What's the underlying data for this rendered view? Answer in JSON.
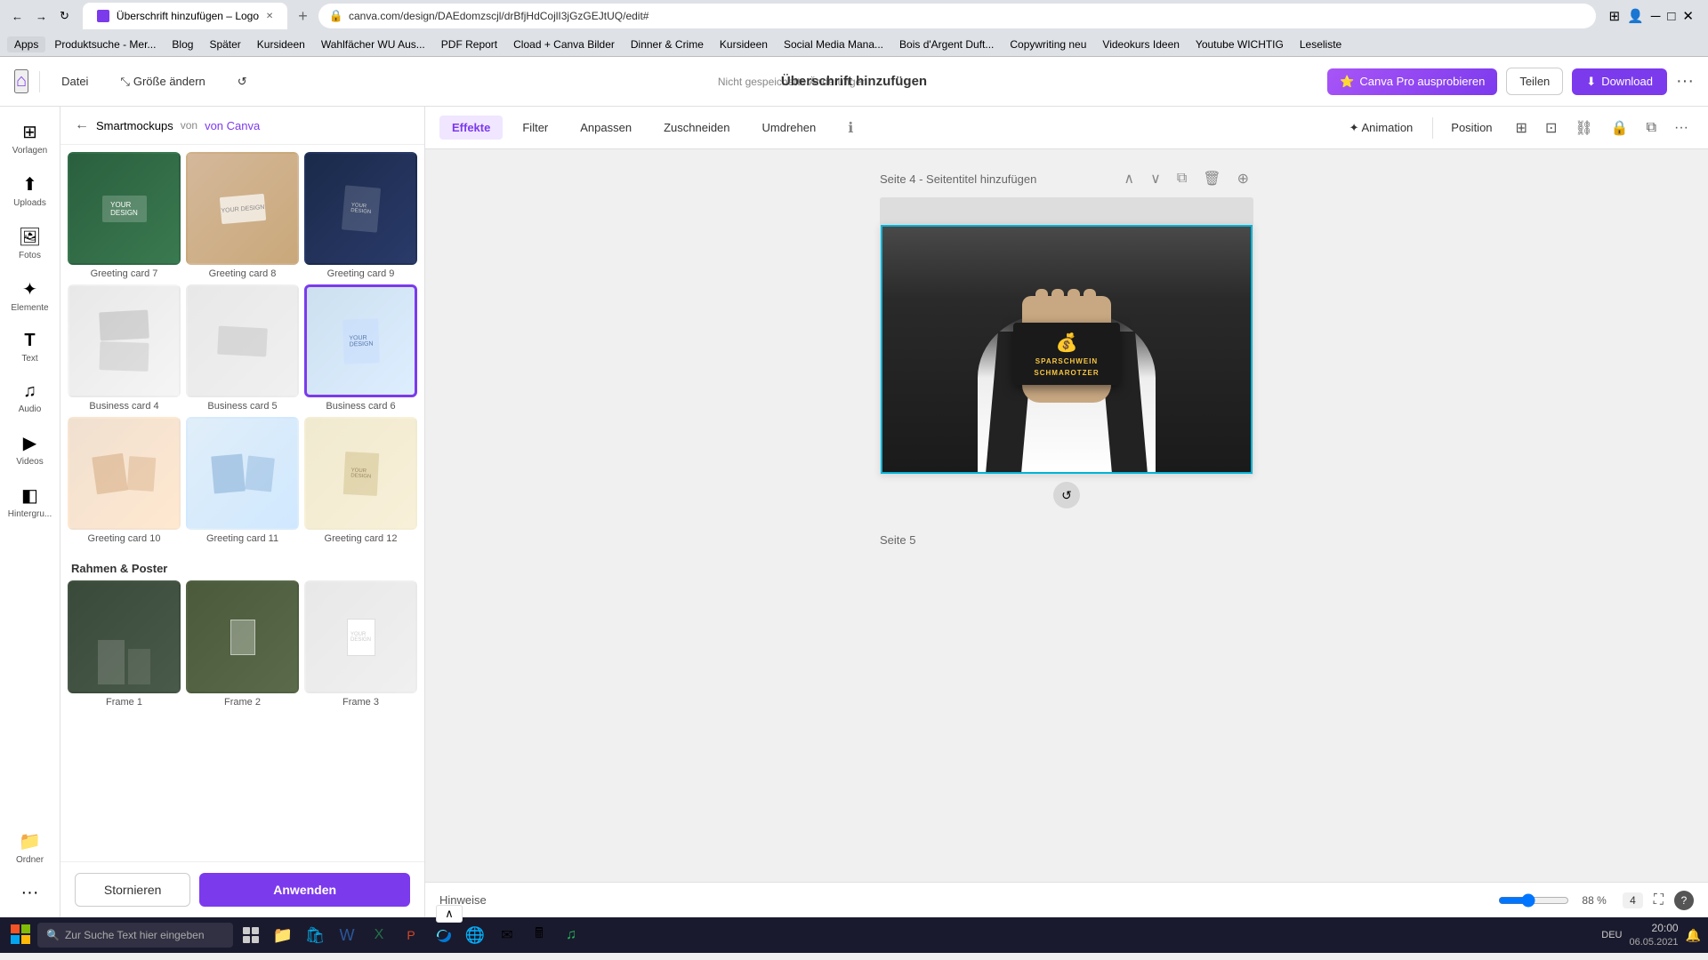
{
  "browser": {
    "tab_title": "Überschrift hinzufügen – Logo",
    "url": "canva.com/design/DAEdomzscjl/drBfjHdCojlI3jGzGEJtUQ/edit#",
    "bookmarks": [
      "Apps",
      "Produktsuche - Mer...",
      "Blog",
      "Später",
      "Kursideen",
      "Wahlfächer WU Aus...",
      "PDF Report",
      "Cload + Canva Bilder",
      "Dinner & Crime",
      "Kursideen",
      "Social Media Mana...",
      "Bois d'Argent Duft...",
      "Copywriting neu",
      "Videokurs Ideen",
      "Youtube WICHTIG",
      "Leseliste"
    ],
    "win_controls": [
      "─",
      "□",
      "✕"
    ]
  },
  "toolbar": {
    "home_label": "Startseite",
    "file_label": "Datei",
    "resize_label": "Größe ändern",
    "unsaved_label": "Nicht gespeicherte Änderungen",
    "project_title": "Überschrift hinzufügen",
    "canva_pro_label": "Canva Pro ausprobieren",
    "share_label": "Teilen",
    "download_label": "Download"
  },
  "sidebar_icons": [
    {
      "id": "vorlagen",
      "label": "Vorlagen",
      "icon": "⊞"
    },
    {
      "id": "uploads",
      "label": "Uploads",
      "icon": "↑"
    },
    {
      "id": "fotos",
      "label": "Fotos",
      "icon": "🖼"
    },
    {
      "id": "elemente",
      "label": "Elemente",
      "icon": "✦"
    },
    {
      "id": "text",
      "label": "Text",
      "icon": "T"
    },
    {
      "id": "audio",
      "label": "Audio",
      "icon": "♪"
    },
    {
      "id": "videos",
      "label": "Videos",
      "icon": "▶"
    },
    {
      "id": "hintergrund",
      "label": "Hintergru...",
      "icon": "◧"
    },
    {
      "id": "ordner",
      "label": "Ordner",
      "icon": "📁"
    },
    {
      "id": "more",
      "label": "...",
      "icon": "···"
    }
  ],
  "panel": {
    "back_label": "←",
    "title": "Smartmockups",
    "source_label": "von Canva",
    "sections": {
      "cards": {
        "items": [
          {
            "id": "greeting-7",
            "label": "Greeting card 7",
            "thumb_class": "thumb-greeting-7",
            "selected": false
          },
          {
            "id": "greeting-8",
            "label": "Greeting card 8",
            "thumb_class": "thumb-greeting-8",
            "selected": false
          },
          {
            "id": "greeting-9",
            "label": "Greeting card 9",
            "thumb_class": "thumb-greeting-9",
            "selected": false
          },
          {
            "id": "biz-4",
            "label": "Business card 4",
            "thumb_class": "thumb-biz-4",
            "selected": false
          },
          {
            "id": "biz-5",
            "label": "Business card 5",
            "thumb_class": "thumb-biz-5",
            "selected": false
          },
          {
            "id": "biz-6",
            "label": "Business card 6",
            "thumb_class": "thumb-biz-6",
            "selected": true
          },
          {
            "id": "greeting-10",
            "label": "Greeting card 10",
            "thumb_class": "thumb-greeting-10",
            "selected": false
          },
          {
            "id": "greeting-11",
            "label": "Greeting card 11",
            "thumb_class": "thumb-greeting-11",
            "selected": false
          },
          {
            "id": "greeting-12",
            "label": "Greeting card 12",
            "thumb_class": "thumb-greeting-12",
            "selected": false
          }
        ]
      },
      "frames": {
        "title": "Rahmen & Poster",
        "items": [
          {
            "id": "frame-1",
            "label": "Frame 1",
            "thumb_class": "thumb-frame-1"
          },
          {
            "id": "frame-2",
            "label": "Frame 2",
            "thumb_class": "thumb-frame-2"
          },
          {
            "id": "frame-3",
            "label": "Frame 3",
            "thumb_class": "thumb-frame-3"
          }
        ]
      }
    },
    "cancel_label": "Stornieren",
    "apply_label": "Anwenden"
  },
  "effect_toolbar": {
    "tabs": [
      "Effekte",
      "Filter",
      "Anpassen",
      "Zuschneiden",
      "Umdrehen"
    ],
    "active_tab": "Effekte",
    "info_icon": "ℹ",
    "animation_label": "Animation",
    "position_label": "Position",
    "icons": [
      "⊞",
      "⊡",
      "⛓",
      "🔒",
      "⧉",
      "⋯"
    ]
  },
  "canvas": {
    "page4": {
      "label": "Seite 4 - Seitentitel hinzufügen",
      "actions": [
        "∧",
        "∨",
        "⧉",
        "🗑",
        "⊕"
      ]
    },
    "page5": {
      "label": "Seite 5"
    },
    "card_text_line1": "SPARSCHWEIN",
    "card_text_line2": "SCHMAROTZER"
  },
  "status_bar": {
    "hints_label": "Hinweise",
    "zoom_value": "88 %",
    "page_indicator": "4",
    "collapse_label": "∧"
  },
  "taskbar": {
    "search_placeholder": "Zur Suche Text hier eingeben",
    "time": "20:00",
    "date": "06.05.2021",
    "language": "DEU"
  }
}
